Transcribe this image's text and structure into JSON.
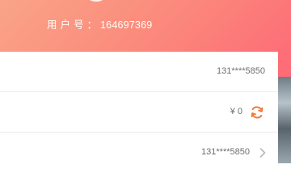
{
  "header": {
    "user_id_label": "用户号：",
    "user_id_value": "164697369"
  },
  "account": {
    "phone_masked": "131****5850"
  },
  "balance": {
    "amount": "¥ 0"
  },
  "binding": {
    "phone_masked": "131****5850"
  },
  "icons": {
    "refresh": "refresh-icon",
    "chevron": "chevron-right-icon",
    "avatar": "avatar"
  },
  "colors": {
    "header_gradient_start": "#f9a487",
    "header_gradient_end": "#fd5f79",
    "refresh_accent": "#f07a3c"
  }
}
